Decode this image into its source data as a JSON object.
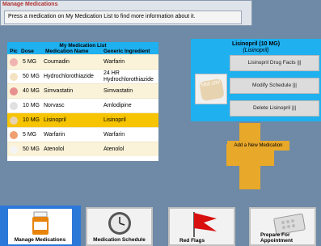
{
  "header": {
    "title": "Manage Medications",
    "instruction": "Press a medication on My Medication List to find more information about it."
  },
  "med_list": {
    "title": "My Medication List",
    "columns": [
      "Pic",
      "Dose",
      "Medication Name",
      "Generic Ingredient"
    ],
    "rows": [
      {
        "dose": "5 MG",
        "name": "Coumadin",
        "generic": "Warfarin",
        "pill_color": "#f0b3b0"
      },
      {
        "dose": "50 MG",
        "name": "Hydrochlorothiazide",
        "generic": "24 HR Hydrochlorothiazide",
        "pill_color": "#f3e3c0"
      },
      {
        "dose": "40 MG",
        "name": "Simvastatin",
        "generic": "Simvastatin",
        "pill_color": "#e89090"
      },
      {
        "dose": "10 MG",
        "name": "Norvasc",
        "generic": "Amlodipine",
        "pill_color": "#e0e0e0"
      },
      {
        "dose": "10 MG",
        "name": "Lisinopril",
        "generic": "Lisinopril",
        "pill_color": "#e8d3b0"
      },
      {
        "dose": "5 MG",
        "name": "Warfarin",
        "generic": "Warfarin",
        "pill_color": "#f0a070"
      },
      {
        "dose": "50 MG",
        "name": "Atenolol",
        "generic": "Atenolol",
        "pill_color": "#f5f5f5"
      }
    ],
    "selected_index": 4
  },
  "detail": {
    "title": "Lisinopril (10 MG)",
    "subtitle": "(Lisinopril)",
    "pill_imprint": "H50 10V",
    "buttons": [
      "Lisinopril Drug Facts |||",
      "Modify Schedule    |||",
      "Delete Lisinopril |||"
    ]
  },
  "add_button": "Add a New Medication",
  "bottom_nav": [
    {
      "label": "Manage Medications",
      "icon": "medicine-bottle-icon",
      "active": true
    },
    {
      "label": "Medication Schedule",
      "icon": "clock-icon",
      "active": false
    },
    {
      "label": "Red Flags",
      "icon": "red-flag-icon",
      "active": false
    },
    {
      "label": "Prepare For Appointment",
      "icon": "pill-pack-icon",
      "active": false
    }
  ]
}
